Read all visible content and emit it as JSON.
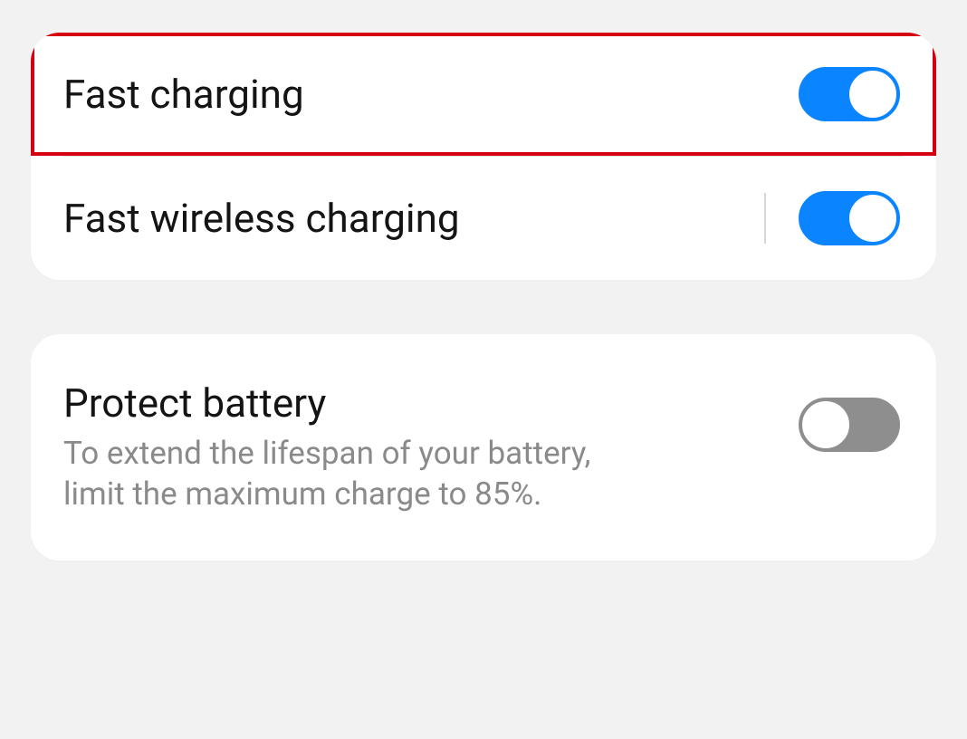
{
  "settings": {
    "charging_group": {
      "fast_charging": {
        "title": "Fast charging",
        "enabled": true
      },
      "fast_wireless_charging": {
        "title": "Fast wireless charging",
        "enabled": true
      }
    },
    "battery_group": {
      "protect_battery": {
        "title": "Protect battery",
        "description": "To extend the lifespan of your battery, limit the maximum charge to 85%.",
        "enabled": false
      }
    }
  },
  "colors": {
    "accent": "#0a84ff",
    "highlight_border": "#d4000f",
    "toggle_off": "#8e8e8e"
  }
}
